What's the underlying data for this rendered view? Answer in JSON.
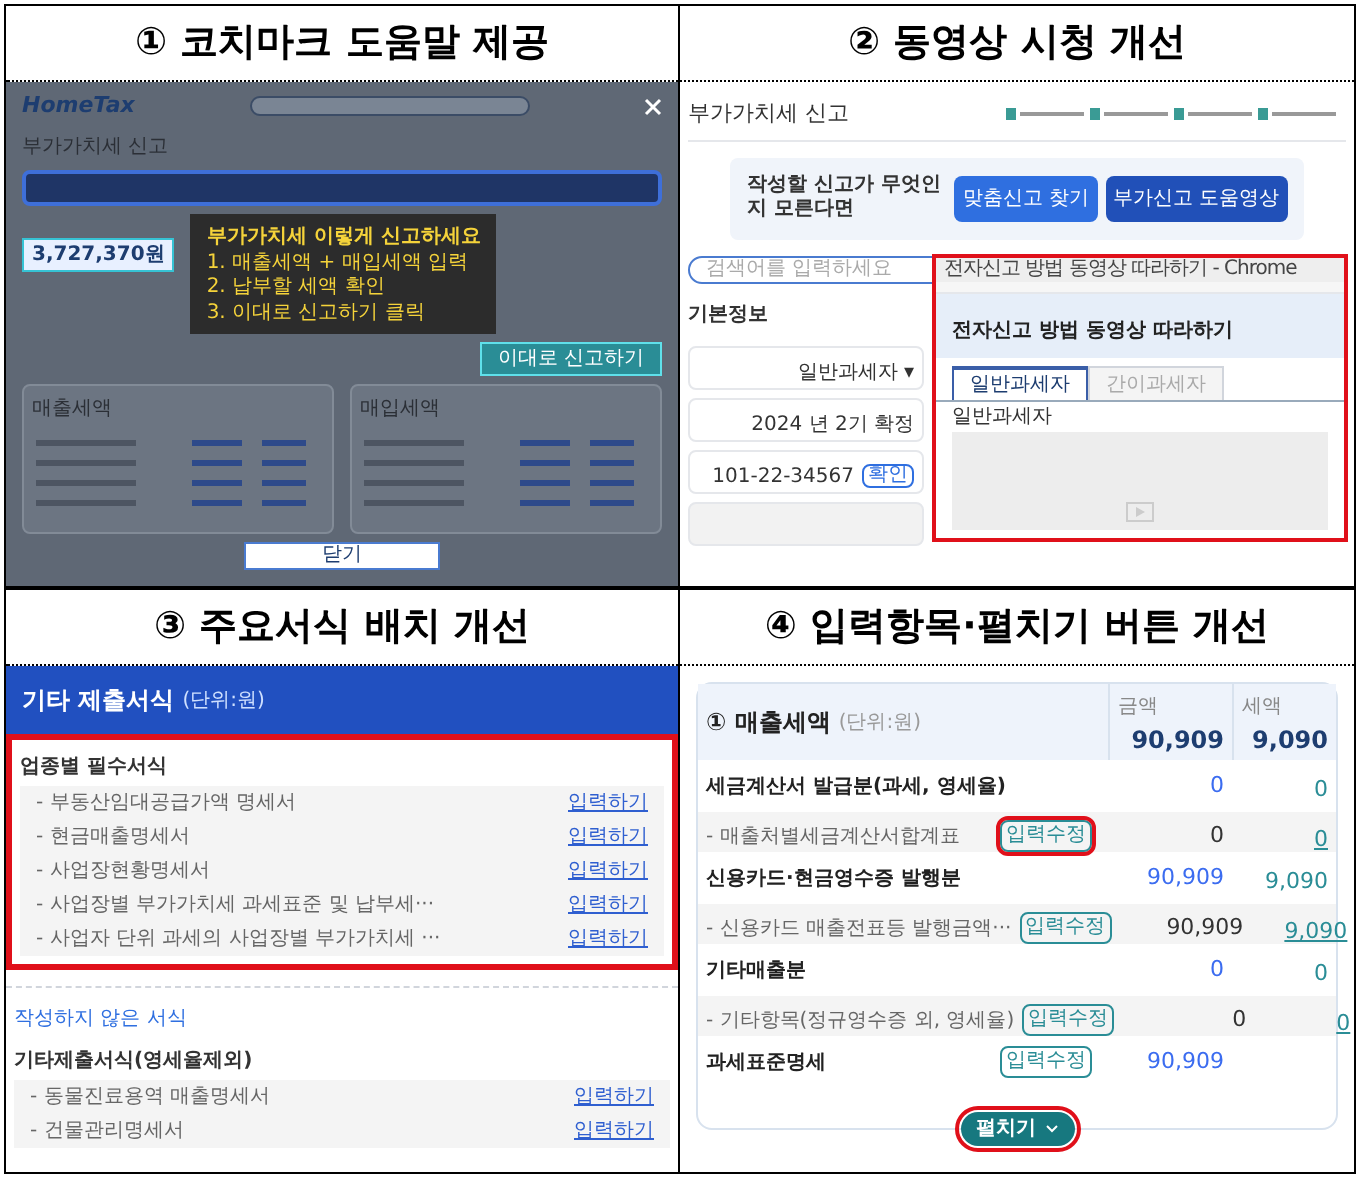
{
  "panels": [
    {
      "number": "①",
      "title": "코치마크 도움말 제공",
      "screen": {
        "logo": "HomeTax",
        "page_title": "부가가치세 신고",
        "tip_title": "부가가치세 이렇게 신고하세요",
        "tip_lines": [
          "1. 매출세액 + 매입세액 입력",
          "2. 납부할 세액 확인",
          "3. 이대로 신고하기 클릭"
        ],
        "amount": "3,727,370원",
        "action": "이대로 신고하기",
        "cards": [
          "매출세액",
          "매입세액"
        ],
        "close": "닫기"
      }
    },
    {
      "number": "②",
      "title": "동영상 시청 개선",
      "screen": {
        "page_title": "부가가치세 신고",
        "prompt": "작성할 신고가 무엇인지 모른다면",
        "buttons": [
          "맞춤신고 찾기",
          "부가신고 도움영상"
        ],
        "search": {
          "placeholder": "검색어를 입력하세요"
        },
        "section": "기본정보",
        "fields": [
          {
            "kind": "value",
            "value": "일반과세자 ▾"
          },
          {
            "kind": "value",
            "value": "2024 년 2기 확정"
          },
          {
            "kind": "value",
            "value": "101-22-34567",
            "button": "확인"
          },
          {
            "kind": "blank"
          }
        ],
        "popup": {
          "window_title": "전자신고 방법 동영상 따라하기 - Chrome",
          "heading": "전자신고 방법 동영상 따라하기",
          "tabs": [
            {
              "label": "일반과세자",
              "selected": true
            },
            {
              "label": "간이과세자",
              "selected": false
            }
          ],
          "subheading": "일반과세자",
          "highlighted": true
        }
      }
    },
    {
      "number": "③",
      "title": "주요서식 배치 개선",
      "screen": {
        "header": "기타 제출서식",
        "unit": "(단위:원)",
        "sections": [
          {
            "title": "업종별 필수서식",
            "highlighted": true,
            "items": [
              {
                "label": "- 부동산임대공급가액 명세서",
                "link": "입력하기"
              },
              {
                "label": "- 현금매출명세서",
                "link": "입력하기"
              },
              {
                "label": "- 사업장현황명세서",
                "link": "입력하기"
              },
              {
                "label": "- 사업장별 부가가치세 과세표준 및 납부세···",
                "link": "입력하기"
              },
              {
                "label": "- 사업자 단위 과세의 사업장별 부가가치세 ···",
                "link": "입력하기"
              }
            ]
          },
          {
            "caption": "작성하지 않은 서식",
            "title": "기타제출서식(영세율제외)",
            "highlighted": false,
            "items": [
              {
                "label": "- 동물진료용역 매출명세서",
                "link": "입력하기"
              },
              {
                "label": "- 건물관리명세서",
                "link": "입력하기"
              }
            ]
          }
        ]
      }
    },
    {
      "number": "④",
      "title": "입력항목·펼치기 버튼 개선",
      "screen": {
        "header": "① 매출세액",
        "unit": "(단위:원)",
        "columns": [
          "금액",
          "세액"
        ],
        "totals": [
          "90,909",
          "9,090"
        ],
        "rows": [
          {
            "kind": "main",
            "label": "세금계산서 발급분(과세, 영세율)",
            "amount": "0",
            "tax": "0"
          },
          {
            "kind": "sub",
            "label": "- 매출처별세금계산서합계표",
            "button": "입력수정",
            "highlighted": true,
            "amount": "0",
            "tax": "0"
          },
          {
            "kind": "main",
            "label": "신용카드·현금영수증 발행분",
            "amount": "90,909",
            "tax": "9,090"
          },
          {
            "kind": "sub",
            "label": "- 신용카드 매출전표등 발행금액···",
            "button": "입력수정",
            "highlighted": false,
            "amount": "90,909",
            "tax": "9,090"
          },
          {
            "kind": "main",
            "label": "기타매출분",
            "amount": "0",
            "tax": "0"
          },
          {
            "kind": "sub",
            "label": "- 기타항목(정규영수증 외, 영세율)",
            "button": "입력수정",
            "highlighted": false,
            "amount": "0",
            "tax": "0"
          },
          {
            "kind": "main",
            "label": "과세표준명세",
            "button": "입력수정",
            "highlighted": false,
            "amount": "90,909"
          }
        ],
        "expand": {
          "label": "펼치기",
          "highlighted": true
        }
      }
    }
  ]
}
